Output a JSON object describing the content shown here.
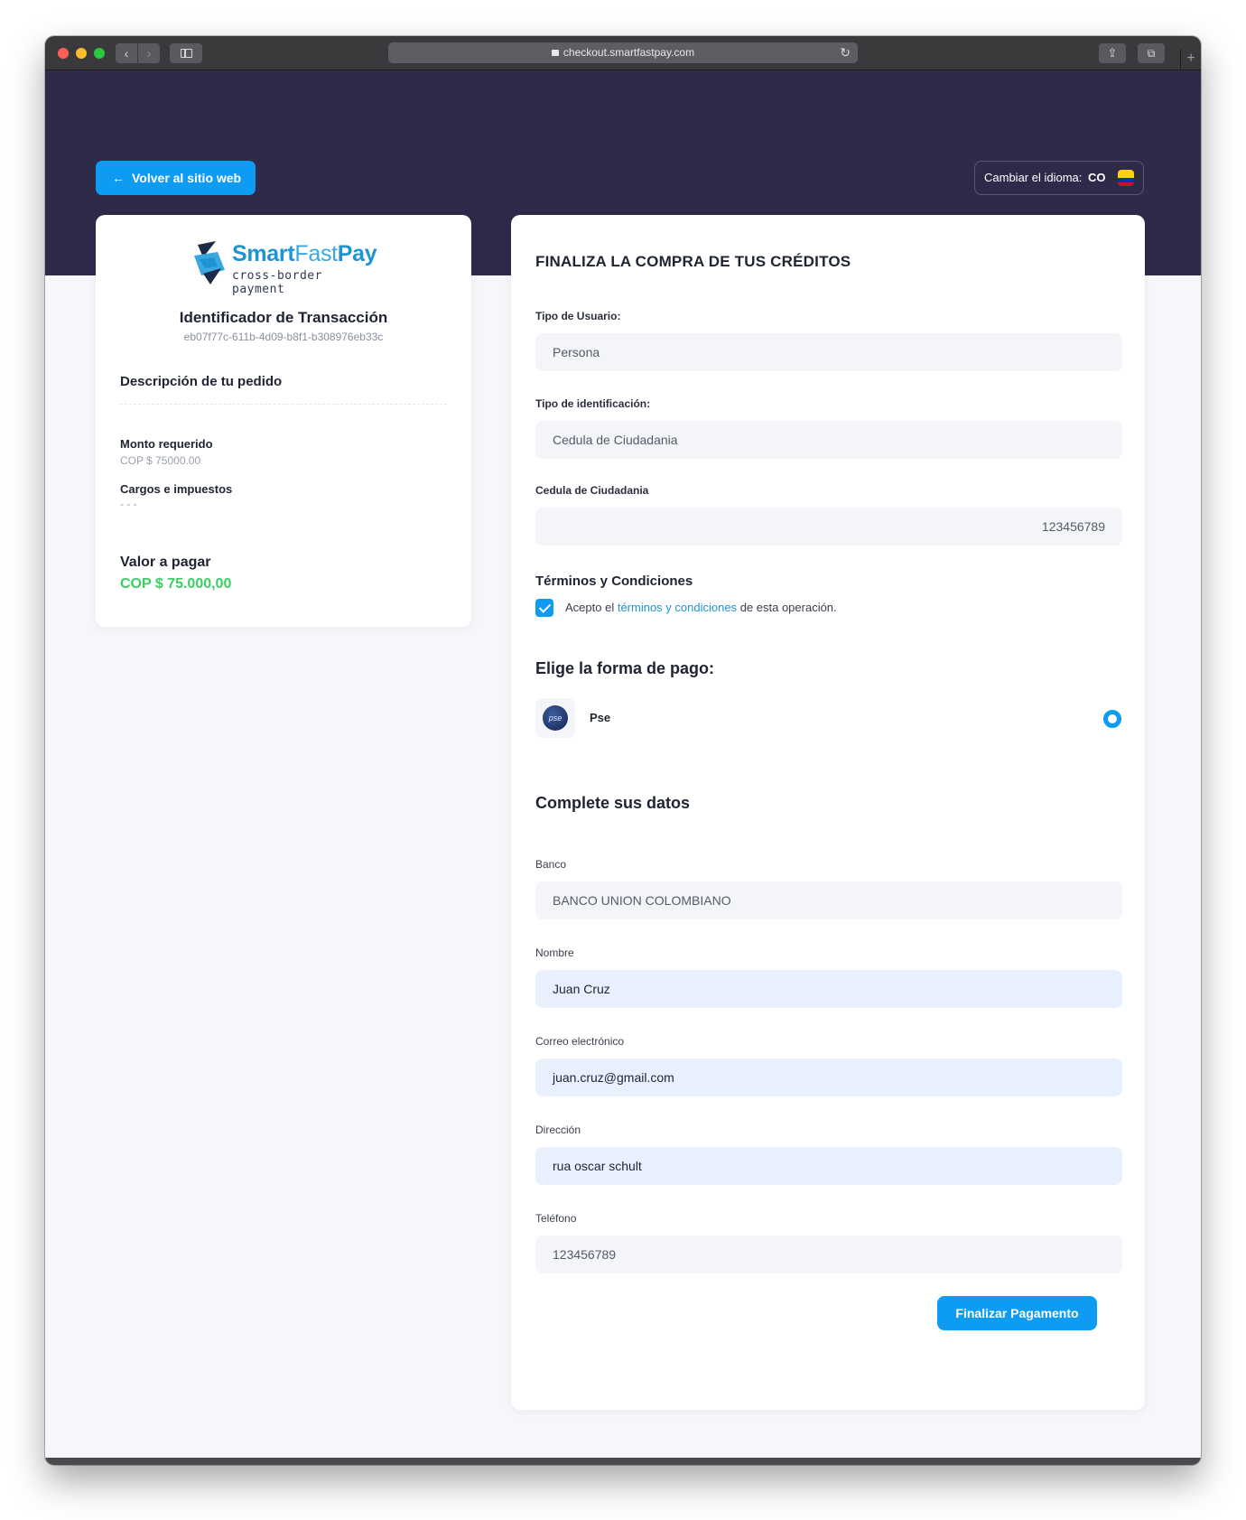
{
  "browser": {
    "url": "checkout.smartfastpay.com"
  },
  "header": {
    "back_label": "Volver al sitio web",
    "language_label": "Cambiar el idioma:",
    "language_code": "CO"
  },
  "brand": {
    "name_part1": "Smart",
    "name_part2": "Fast",
    "name_part3": "Pay",
    "tagline": "cross-border payment",
    "color": "#1f94d2"
  },
  "summary": {
    "tx_title": "Identificador de Transacción",
    "tx_id": "eb07f77c-611b-4d09-b8f1-b308976eb33c",
    "description_title": "Descripción de tu pedido",
    "amount_label": "Monto requerido",
    "amount_value": "COP $ 75000.00",
    "charges_label": "Cargos e impuestos",
    "charges_value": "- - -",
    "total_label": "Valor a pagar",
    "total_value": "COP $ 75.000,00",
    "total_color": "#3ccf62"
  },
  "form": {
    "title": "FINALIZA LA COMPRA DE TUS CRÉDITOS",
    "user_type_label": "Tipo de Usuario:",
    "user_type_value": "Persona",
    "id_type_label": "Tipo de identificación:",
    "id_type_value": "Cedula de Ciudadania",
    "id_number_label": "Cedula de Ciudadania",
    "id_number_value": "123456789",
    "terms_title": "Términos y Condiciones",
    "terms_prefix": "Acepto el",
    "terms_link": "términos y condiciones",
    "terms_suffix": "de esta operación.",
    "terms_checked": true,
    "payment_title": "Elige la forma de pago:",
    "payment_method": "Pse",
    "payment_logo_text": "pse",
    "details_title": "Complete sus datos",
    "bank_label": "Banco",
    "bank_value": "BANCO UNION COLOMBIANO",
    "name_label": "Nombre",
    "name_value": "Juan Cruz",
    "email_label": "Correo electrónico",
    "email_value": "juan.cruz@gmail.com",
    "address_label": "Dirección",
    "address_value": "rua oscar schult",
    "phone_label": "Teléfono",
    "phone_value": "123456789",
    "submit_label": "Finalizar Pagamento",
    "accent_color": "#0d9cf2"
  }
}
